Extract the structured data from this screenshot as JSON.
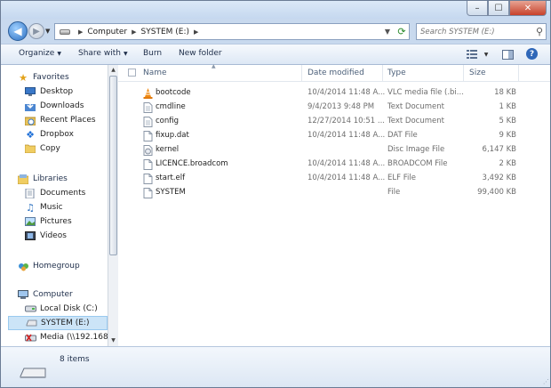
{
  "window": {
    "controls": {
      "minimize": "–",
      "maximize": "☐",
      "close": "✕"
    }
  },
  "address_bar": {
    "crumbs": [
      "Computer",
      "SYSTEM (E:)"
    ],
    "search_placeholder": "Search SYSTEM (E:)"
  },
  "toolbar": {
    "organize": "Organize",
    "share_with": "Share with",
    "burn": "Burn",
    "new_folder": "New folder"
  },
  "sidebar": {
    "favorites": {
      "label": "Favorites",
      "items": [
        "Desktop",
        "Downloads",
        "Recent Places",
        "Dropbox",
        "Copy"
      ]
    },
    "libraries": {
      "label": "Libraries",
      "items": [
        "Documents",
        "Music",
        "Pictures",
        "Videos"
      ]
    },
    "homegroup": {
      "label": "Homegroup"
    },
    "computer": {
      "label": "Computer",
      "items": [
        "Local Disk (C:)",
        "SYSTEM (E:)",
        "Media (\\\\192.168.1"
      ]
    }
  },
  "columns": {
    "name": "Name",
    "date": "Date modified",
    "type": "Type",
    "size": "Size"
  },
  "files": [
    {
      "name": "bootcode",
      "date": "10/4/2014 11:48 A...",
      "type": "VLC media file (.bi...",
      "size": "18 KB",
      "icon": "vlc-cone-icon"
    },
    {
      "name": "cmdline",
      "date": "9/4/2013 9:48 PM",
      "type": "Text Document",
      "size": "1 KB",
      "icon": "text-file-icon"
    },
    {
      "name": "config",
      "date": "12/27/2014 10:51 ...",
      "type": "Text Document",
      "size": "5 KB",
      "icon": "text-file-icon"
    },
    {
      "name": "fixup.dat",
      "date": "10/4/2014 11:48 A...",
      "type": "DAT File",
      "size": "9 KB",
      "icon": "file-icon"
    },
    {
      "name": "kernel",
      "date": "",
      "type": "Disc Image File",
      "size": "6,147 KB",
      "icon": "disc-image-icon"
    },
    {
      "name": "LICENCE.broadcom",
      "date": "10/4/2014 11:48 A...",
      "type": "BROADCOM File",
      "size": "2 KB",
      "icon": "file-icon"
    },
    {
      "name": "start.elf",
      "date": "10/4/2014 11:48 A...",
      "type": "ELF File",
      "size": "3,492 KB",
      "icon": "file-icon"
    },
    {
      "name": "SYSTEM",
      "date": "",
      "type": "File",
      "size": "99,400 KB",
      "icon": "file-icon"
    }
  ],
  "status": {
    "item_count": "8 items"
  }
}
